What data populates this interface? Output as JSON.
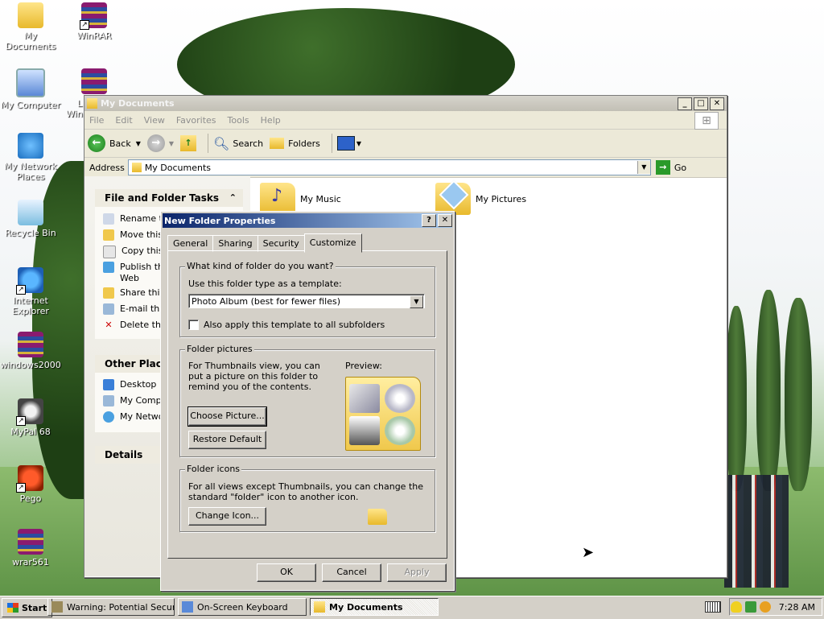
{
  "desktop": {
    "icons": [
      {
        "label": "My Documents",
        "icon": "my-documents-icon"
      },
      {
        "label": "WinRAR",
        "icon": "winrar-icon"
      },
      {
        "label": "My Computer",
        "icon": "my-computer-icon"
      },
      {
        "label": "My Network Places",
        "icon": "network-places-icon"
      },
      {
        "label": "Recycle Bin",
        "icon": "recycle-bin-icon"
      },
      {
        "label": "Internet Explorer",
        "icon": "internet-explorer-icon"
      },
      {
        "label": "windows2000",
        "icon": "winrar-archive-icon"
      },
      {
        "label": "MyPal 68",
        "icon": "mypal-icon"
      },
      {
        "label": "Pego",
        "icon": "pego-icon"
      },
      {
        "label": "wrar561",
        "icon": "winrar-archive-icon"
      }
    ],
    "partial_label_1": "L",
    "partial_label_2": "Win"
  },
  "explorer": {
    "title": "My Documents",
    "menu": [
      "File",
      "Edit",
      "View",
      "Favorites",
      "Tools",
      "Help"
    ],
    "toolbar": {
      "back": "Back",
      "search": "Search",
      "folders": "Folders"
    },
    "address_label": "Address",
    "address_value": "My Documents",
    "go_label": "Go",
    "tasks": {
      "file_folder_title": "File and Folder Tasks",
      "items": [
        "Rename t",
        "Move this",
        "Copy this",
        "Publish th",
        "Web",
        "Share this",
        "E-mail thi",
        "Delete th"
      ]
    },
    "other_places": {
      "title": "Other Places",
      "items": [
        "Desktop",
        "My Comp",
        "My Netwo"
      ]
    },
    "details_title": "Details",
    "files": [
      "My Music",
      "My Pictures"
    ]
  },
  "dialog": {
    "title": "New Folder Properties",
    "tabs": [
      "General",
      "Sharing",
      "Security",
      "Customize"
    ],
    "active_tab": "Customize",
    "kind": {
      "legend": "What kind of folder do you want?",
      "template_label": "Use this folder type as a template:",
      "template_value": "Photo Album (best for fewer files)",
      "apply_subfolders": "Also apply this template to all subfolders",
      "apply_checked": false
    },
    "pictures": {
      "legend": "Folder pictures",
      "description": "For Thumbnails view, you can put a picture on this folder to remind you of the contents.",
      "preview_label": "Preview:",
      "choose_button": "Choose Picture...",
      "restore_button": "Restore Default"
    },
    "icons": {
      "legend": "Folder icons",
      "description": "For all views except Thumbnails, you can change the standard \"folder\" icon to another icon.",
      "change_button": "Change Icon..."
    },
    "buttons": {
      "ok": "OK",
      "cancel": "Cancel",
      "apply": "Apply"
    }
  },
  "taskbar": {
    "start": "Start",
    "tasks": [
      "Warning: Potential Secur...",
      "On-Screen Keyboard",
      "My Documents"
    ],
    "active_task": "My Documents",
    "clock": "7:28 AM"
  }
}
